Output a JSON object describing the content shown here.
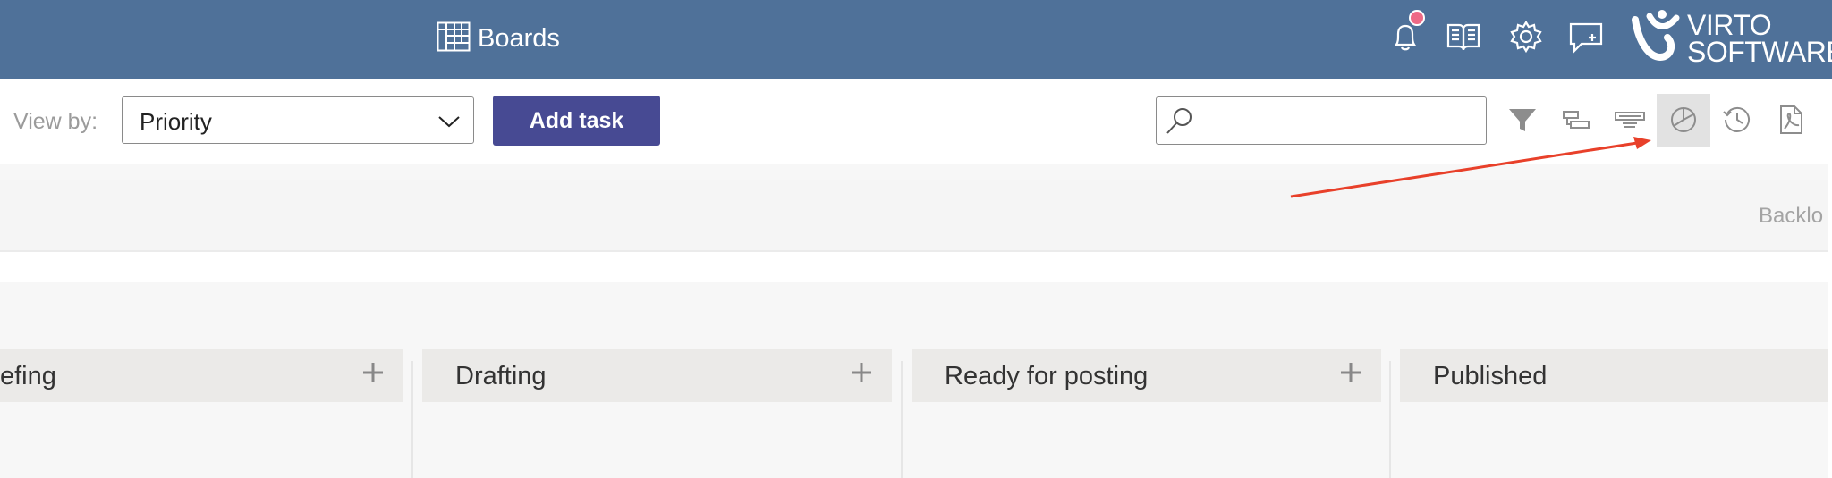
{
  "header": {
    "title": "Boards",
    "logo_line1": "VIRTO",
    "logo_line2": "SOFTWARE",
    "accent_color": "#4f7199",
    "notification_dot_color": "#ee6a86",
    "icons": [
      "boards-grid-icon",
      "bell-icon",
      "book-icon",
      "gear-icon",
      "chat-plus-icon",
      "virto-logo-icon"
    ]
  },
  "toolbar": {
    "view_by_label": "View by:",
    "view_by_value": "Priority",
    "add_task_label": "Add task",
    "add_task_color": "#474a93",
    "search_placeholder": "",
    "icons": [
      "filter-icon",
      "gantt-icon",
      "timeline-icon",
      "chart-pie-icon",
      "history-icon",
      "pdf-icon"
    ],
    "active_icon": "chart-pie-icon"
  },
  "board": {
    "swimlane_title": "Backlo",
    "columns": [
      {
        "title": "efing",
        "has_add": true
      },
      {
        "title": "Drafting",
        "has_add": true
      },
      {
        "title": "Ready for posting",
        "has_add": true
      },
      {
        "title": "Published",
        "has_add": false
      }
    ]
  },
  "annotation": {
    "arrow_color": "#e8402a"
  }
}
